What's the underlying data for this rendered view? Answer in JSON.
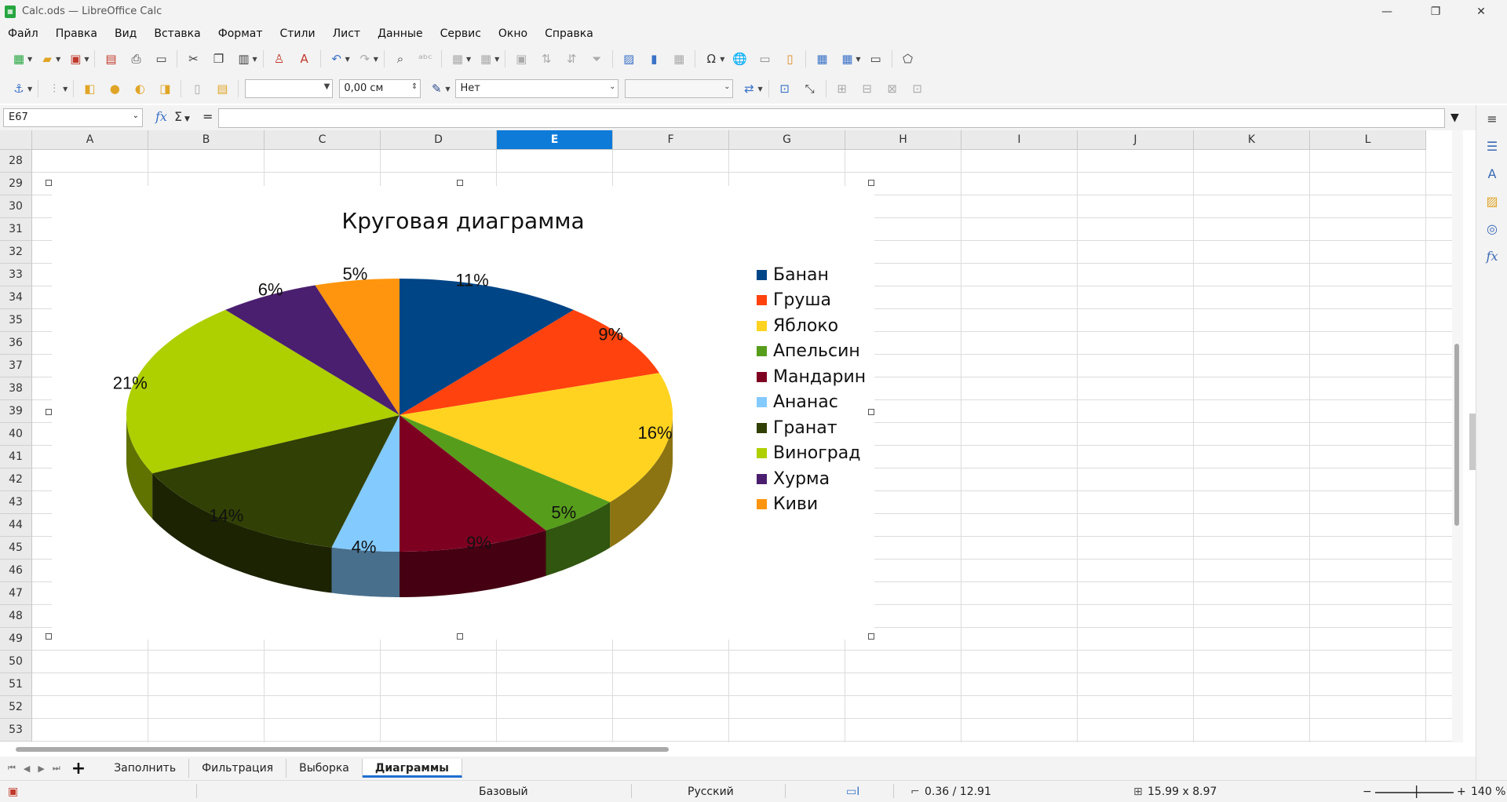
{
  "window": {
    "title": "Calc.ods — LibreOffice Calc",
    "controls": [
      "—",
      "❐",
      "✕"
    ]
  },
  "menu": [
    "Файл",
    "Правка",
    "Вид",
    "Вставка",
    "Формат",
    "Стили",
    "Лист",
    "Данные",
    "Сервис",
    "Окно",
    "Справка"
  ],
  "toolbar2": {
    "line_width": "0,00 см",
    "area_style": "Нет"
  },
  "formula": {
    "cell_ref": "E67",
    "fx": "fx",
    "sigma": "Σ",
    "equals": "=",
    "content": ""
  },
  "columns": [
    "A",
    "B",
    "C",
    "D",
    "E",
    "F",
    "G",
    "H",
    "I",
    "J",
    "K",
    "L"
  ],
  "selected_column": "E",
  "rows": [
    "28",
    "29",
    "30",
    "31",
    "32",
    "33",
    "34",
    "35",
    "36",
    "37",
    "38",
    "39",
    "40",
    "41",
    "42",
    "43",
    "44",
    "45",
    "46",
    "47",
    "48",
    "49",
    "50",
    "51",
    "52",
    "53"
  ],
  "chart_data": {
    "type": "pie",
    "title": "Круговая диаграмма",
    "is_3d": true,
    "legend_position": "right",
    "slices": [
      {
        "name": "Банан",
        "value": 11,
        "label": "11%",
        "color": "#004586"
      },
      {
        "name": "Груша",
        "value": 9,
        "label": "9%",
        "color": "#ff420e"
      },
      {
        "name": "Яблоко",
        "value": 16,
        "label": "16%",
        "color": "#ffd320"
      },
      {
        "name": "Апельсин",
        "value": 5,
        "label": "5%",
        "color": "#579d1c"
      },
      {
        "name": "Мандарин",
        "value": 9,
        "label": "9%",
        "color": "#7e0021"
      },
      {
        "name": "Ананас",
        "value": 4,
        "label": "4%",
        "color": "#83caff"
      },
      {
        "name": "Гранат",
        "value": 14,
        "label": "14%",
        "color": "#314004"
      },
      {
        "name": "Виноград",
        "value": 21,
        "label": "21%",
        "color": "#aecf00"
      },
      {
        "name": "Хурма",
        "value": 6,
        "label": "6%",
        "color": "#4b1f6f"
      },
      {
        "name": "Киви",
        "value": 5,
        "label": "5%",
        "color": "#ff950e"
      }
    ]
  },
  "sheets": [
    "Заполнить",
    "Фильтрация",
    "Выборка",
    "Диаграммы"
  ],
  "active_sheet": "Диаграммы",
  "status": {
    "page_style": "Базовый",
    "language": "Русский",
    "position": "0.36 / 12.91",
    "size": "15.99 x 8.97",
    "zoom": "140 %"
  }
}
